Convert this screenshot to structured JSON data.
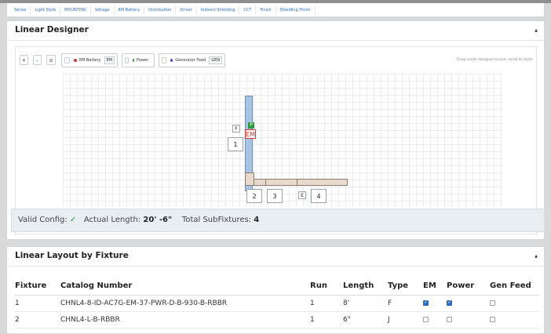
{
  "tabs": [
    "Series",
    "Light Style",
    "MOUNTING",
    "Voltage",
    "EM Battery",
    "Distribution",
    "Driver",
    "Indirect Shielding",
    "CCT",
    "Finish",
    "Shielding Finish"
  ],
  "designer": {
    "title": "Linear Designer",
    "zoom_in": "+",
    "zoom_out": "-",
    "reset": "⊙",
    "legend": {
      "em_label": "EM Battery",
      "em_tag": "EM",
      "em_color": "#d33b3b",
      "power_label": "Power",
      "power_color": "#2f9a3a",
      "gen_label": "Generator Feed",
      "gen_tag": "GEN",
      "gen_color": "#6a3fc4"
    },
    "drag_hint": "Drag inside designer to pan, scroll to zoom",
    "tags": {
      "f": "F",
      "p": "P",
      "em": "EM",
      "e": "E"
    },
    "numbers": [
      "1",
      "2",
      "3",
      "4"
    ]
  },
  "status": {
    "valid_label": "Valid Config:",
    "valid_mark": "✓",
    "length_label": "Actual Length:",
    "length_value": "20' -6\"",
    "subfixtures_label": "Total SubFixtures:",
    "subfixtures_value": "4"
  },
  "layout": {
    "title": "Linear Layout by Fixture",
    "headers": [
      "Fixture",
      "Catalog Number",
      "Run",
      "Length",
      "Type",
      "EM",
      "Power",
      "Gen Feed"
    ],
    "rows": [
      {
        "fixture": "1",
        "catalog": "CHNL4-8-ID-AC7G-EM-37-PWR-D-B-930-B-RBBR",
        "run": "1",
        "length": "8'",
        "type": "F",
        "em": true,
        "power": true,
        "gen": false
      },
      {
        "fixture": "2",
        "catalog": "CHNL4-L-B-RBBR",
        "run": "1",
        "length": "6\"",
        "type": "J",
        "em": false,
        "power": false,
        "gen": false
      }
    ]
  }
}
